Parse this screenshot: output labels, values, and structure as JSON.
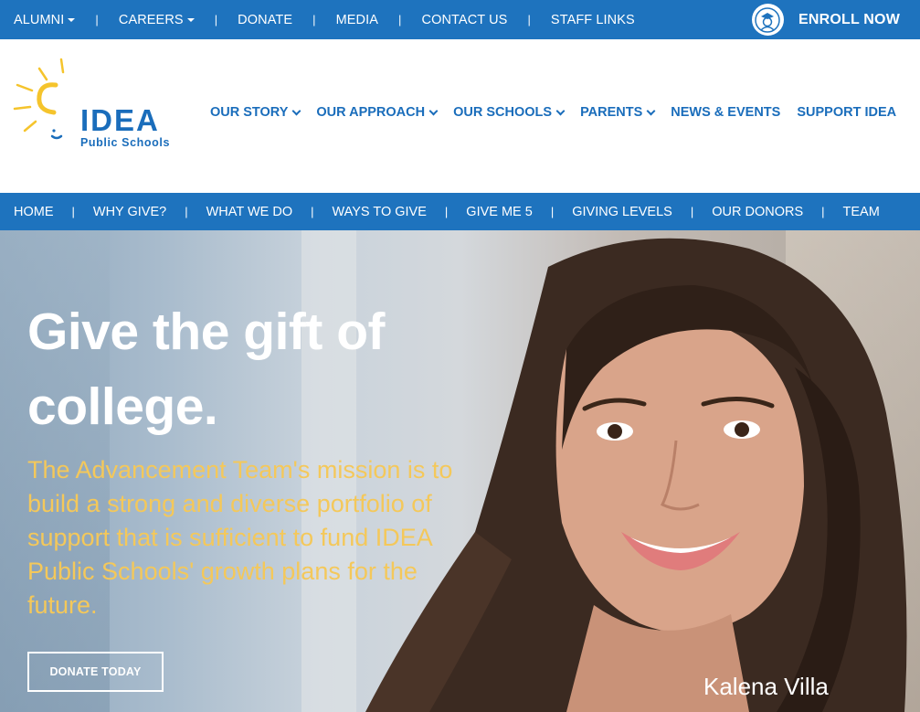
{
  "topbar": {
    "links": [
      "ALUMNI",
      "CAREERS",
      "DONATE",
      "MEDIA",
      "CONTACT US",
      "STAFF LINKS"
    ],
    "enroll": "ENROLL NOW"
  },
  "logo": {
    "name": "IDEA",
    "tagline": "Public Schools"
  },
  "mainnav": [
    "OUR STORY",
    "OUR APPROACH",
    "OUR SCHOOLS",
    "PARENTS",
    "NEWS & EVENTS",
    "SUPPORT IDEA"
  ],
  "subnav": [
    "HOME",
    "WHY GIVE?",
    "WHAT WE DO",
    "WAYS TO GIVE",
    "GIVE ME 5",
    "GIVING LEVELS",
    "OUR DONORS",
    "TEAM"
  ],
  "hero": {
    "headline": "Give the gift of college.",
    "mission": "The Advancement Team's mission is to build a strong and diverse portfolio of support that is sufficient to fund IDEA Public Schools' growth plans for the future.",
    "button": "DONATE TODAY",
    "caption": "Kalena Villa"
  },
  "colors": {
    "brand_blue": "#1e73be",
    "mission_yellow": "#f4c85a",
    "logo_sun": "#f5c42c"
  }
}
